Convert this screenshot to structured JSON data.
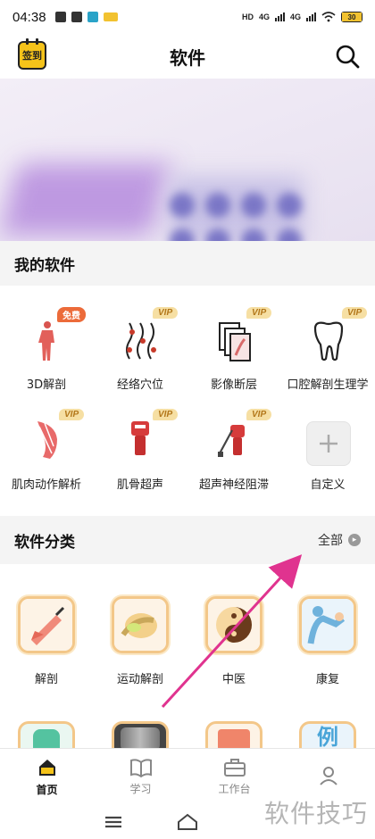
{
  "status": {
    "time": "04:38",
    "right_text": "HD 4G 4G",
    "battery": "30"
  },
  "header": {
    "checkin_label": "签到",
    "title": "软件"
  },
  "my_software": {
    "title": "我的软件",
    "items": [
      {
        "label": "3D解剖",
        "badge": "免费"
      },
      {
        "label": "经络穴位",
        "badge": "VIP"
      },
      {
        "label": "影像断层",
        "badge": "VIP"
      },
      {
        "label": "口腔解剖生理学",
        "badge": "VIP"
      },
      {
        "label": "肌肉动作解析",
        "badge": "VIP"
      },
      {
        "label": "肌骨超声",
        "badge": "VIP"
      },
      {
        "label": "超声神经阻滞",
        "badge": "VIP"
      },
      {
        "label": "自定义",
        "badge": ""
      }
    ]
  },
  "categories": {
    "title": "软件分类",
    "more_label": "全部",
    "items": [
      {
        "label": "解剖"
      },
      {
        "label": "运动解剖"
      },
      {
        "label": "中医"
      },
      {
        "label": "康复"
      }
    ],
    "partial_row": [
      "",
      "",
      "",
      "例"
    ]
  },
  "bottom_nav": [
    {
      "label": "首页",
      "icon": "home-icon",
      "active": true
    },
    {
      "label": "学习",
      "icon": "book-icon",
      "active": false
    },
    {
      "label": "工作台",
      "icon": "briefcase-icon",
      "active": false
    },
    {
      "label": "",
      "icon": "person-icon",
      "active": false
    }
  ],
  "watermark": "软件技巧",
  "colors": {
    "accent": "#f5c31a",
    "vip_bg": "#f6dfa3",
    "free_bg": "#ec6b3a",
    "arrow": "#e0338f"
  }
}
